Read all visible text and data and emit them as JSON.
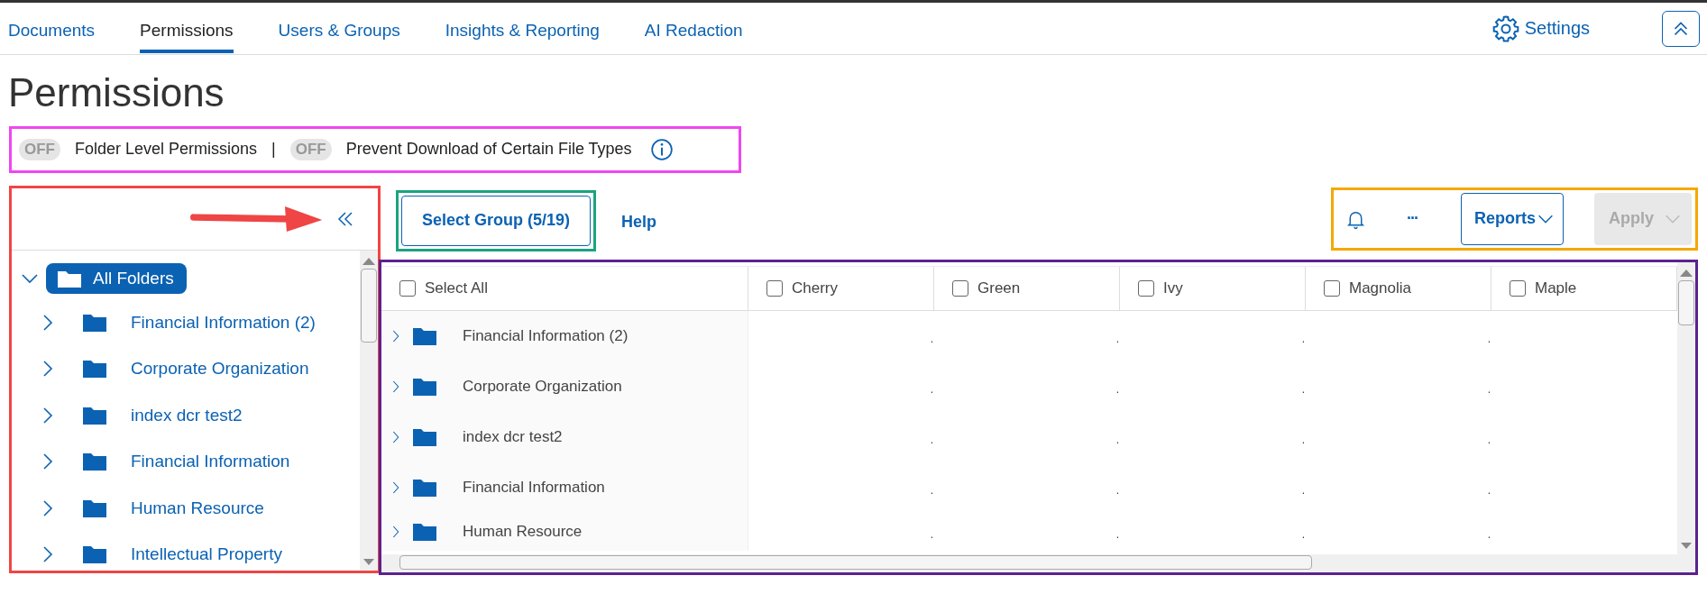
{
  "nav": {
    "tabs": [
      {
        "label": "Documents",
        "selected": false
      },
      {
        "label": "Permissions",
        "selected": true
      },
      {
        "label": "Users & Groups",
        "selected": false
      },
      {
        "label": "Insights & Reporting",
        "selected": false
      },
      {
        "label": "AI Redaction",
        "selected": false
      }
    ],
    "settings": "Settings"
  },
  "title": "Permissions",
  "toggles": [
    {
      "state": "OFF",
      "on": false,
      "label": "Folder Level Permissions"
    },
    {
      "state": "OFF",
      "on": false,
      "label": "Prevent Download of Certain File Types"
    }
  ],
  "toggle_separator": "|",
  "frames": [
    {
      "kind": "toggles",
      "color": "#f046f0"
    },
    {
      "kind": "tree",
      "color": "#f04545"
    },
    {
      "kind": "group",
      "color": "#1aa37f"
    },
    {
      "kind": "toolbar",
      "color": "#f5a800"
    },
    {
      "kind": "table",
      "color": "#5b2290"
    }
  ],
  "tree": {
    "root": {
      "label": "All Folders",
      "expanded": true,
      "selected": true
    },
    "children": [
      {
        "label": "Financial Information (2)"
      },
      {
        "label": "Corporate Organization"
      },
      {
        "label": "index dcr test2"
      },
      {
        "label": "Financial Information"
      },
      {
        "label": "Human Resource"
      },
      {
        "label": "Intellectual Property"
      }
    ]
  },
  "select_group": "Select Group (5/19)",
  "help": "Help",
  "toolbar": {
    "more": "···",
    "reports": "Reports",
    "apply": {
      "label": "Apply",
      "disabled": true
    }
  },
  "table": {
    "columns": [
      {
        "label": "Select All",
        "checked": false
      },
      {
        "label": "Cherry",
        "checked": false
      },
      {
        "label": "Green",
        "checked": false
      },
      {
        "label": "Ivy",
        "checked": false
      },
      {
        "label": "Magnolia",
        "checked": false
      },
      {
        "label": "Maple",
        "checked": false
      }
    ],
    "rows": [
      {
        "folder": "Financial Information (2)",
        "cells": [
          ".",
          ".",
          ".",
          "."
        ]
      },
      {
        "folder": "Corporate Organization",
        "cells": [
          ".",
          ".",
          ".",
          "."
        ]
      },
      {
        "folder": "index dcr test2",
        "cells": [
          ".",
          ".",
          ".",
          "."
        ]
      },
      {
        "folder": "Financial Information",
        "cells": [
          ".",
          ".",
          ".",
          "."
        ]
      },
      {
        "folder": "Human Resource",
        "cells": [
          ".",
          ".",
          ".",
          "."
        ]
      }
    ]
  }
}
